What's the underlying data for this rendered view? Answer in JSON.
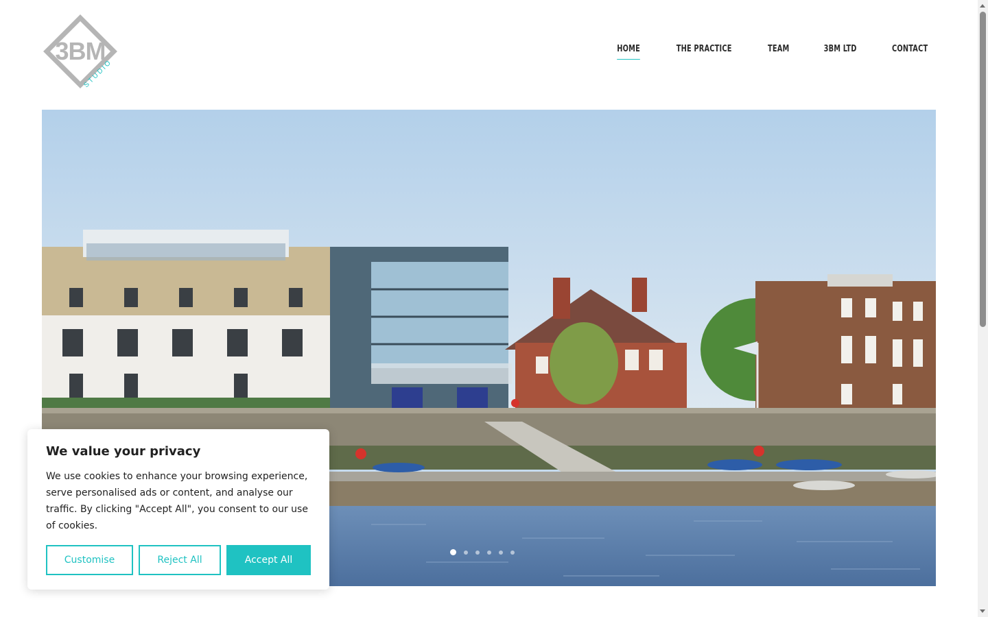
{
  "logo": {
    "main_text": "3BM",
    "sub_text": "STUDIO",
    "icon": "logo-diamond-icon"
  },
  "nav": {
    "items": [
      {
        "label": "HOME",
        "active": true
      },
      {
        "label": "THE PRACTICE",
        "active": false
      },
      {
        "label": "TEAM",
        "active": false
      },
      {
        "label": "3BM LTD",
        "active": false
      },
      {
        "label": "CONTACT",
        "active": false
      }
    ]
  },
  "hero": {
    "slide_count": 6,
    "active_slide": 1,
    "image": "riverside-buildings-with-pontoon-and-boats"
  },
  "cookie_banner": {
    "title": "We value your privacy",
    "body": "We use cookies to enhance your browsing experience, serve personalised ads or content, and analyse our traffic. By clicking \"Accept All\", you consent to our use of cookies.",
    "customise_label": "Customise",
    "reject_label": "Reject All",
    "accept_label": "Accept All"
  },
  "colors": {
    "accent": "#1fc2c2",
    "text": "#2b2b2b",
    "logo_grey": "#b5b5b5"
  }
}
